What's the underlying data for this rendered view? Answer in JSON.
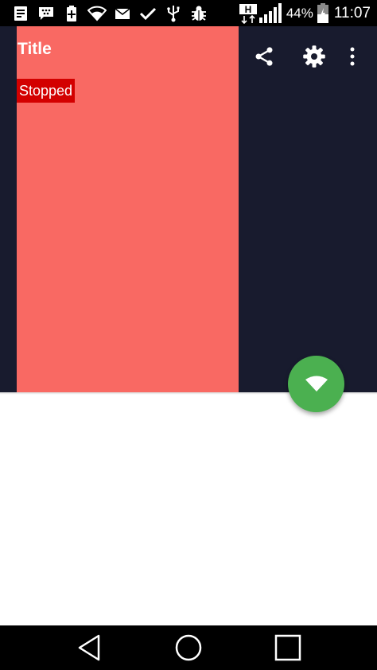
{
  "status_bar": {
    "battery_percent": "44%",
    "time": "11:07",
    "network_type": "H",
    "notification_icons": [
      "notes-icon",
      "bbm-icon",
      "battery-saver-icon",
      "wifi-icon",
      "email-icon",
      "check-icon",
      "usb-icon",
      "debug-icon"
    ]
  },
  "toolbar": {
    "title": "Title",
    "actions": [
      "share-icon",
      "settings-icon",
      "overflow-menu-icon"
    ]
  },
  "content": {
    "status_label": "Stopped"
  },
  "fab": {
    "icon": "wifi-icon",
    "color": "#4bb050"
  },
  "colors": {
    "background_dark": "#181b2e",
    "panel": "#f96963",
    "status_badge": "#d30000"
  },
  "nav_bar": {
    "buttons": [
      "back-icon",
      "home-icon",
      "recents-icon"
    ]
  }
}
